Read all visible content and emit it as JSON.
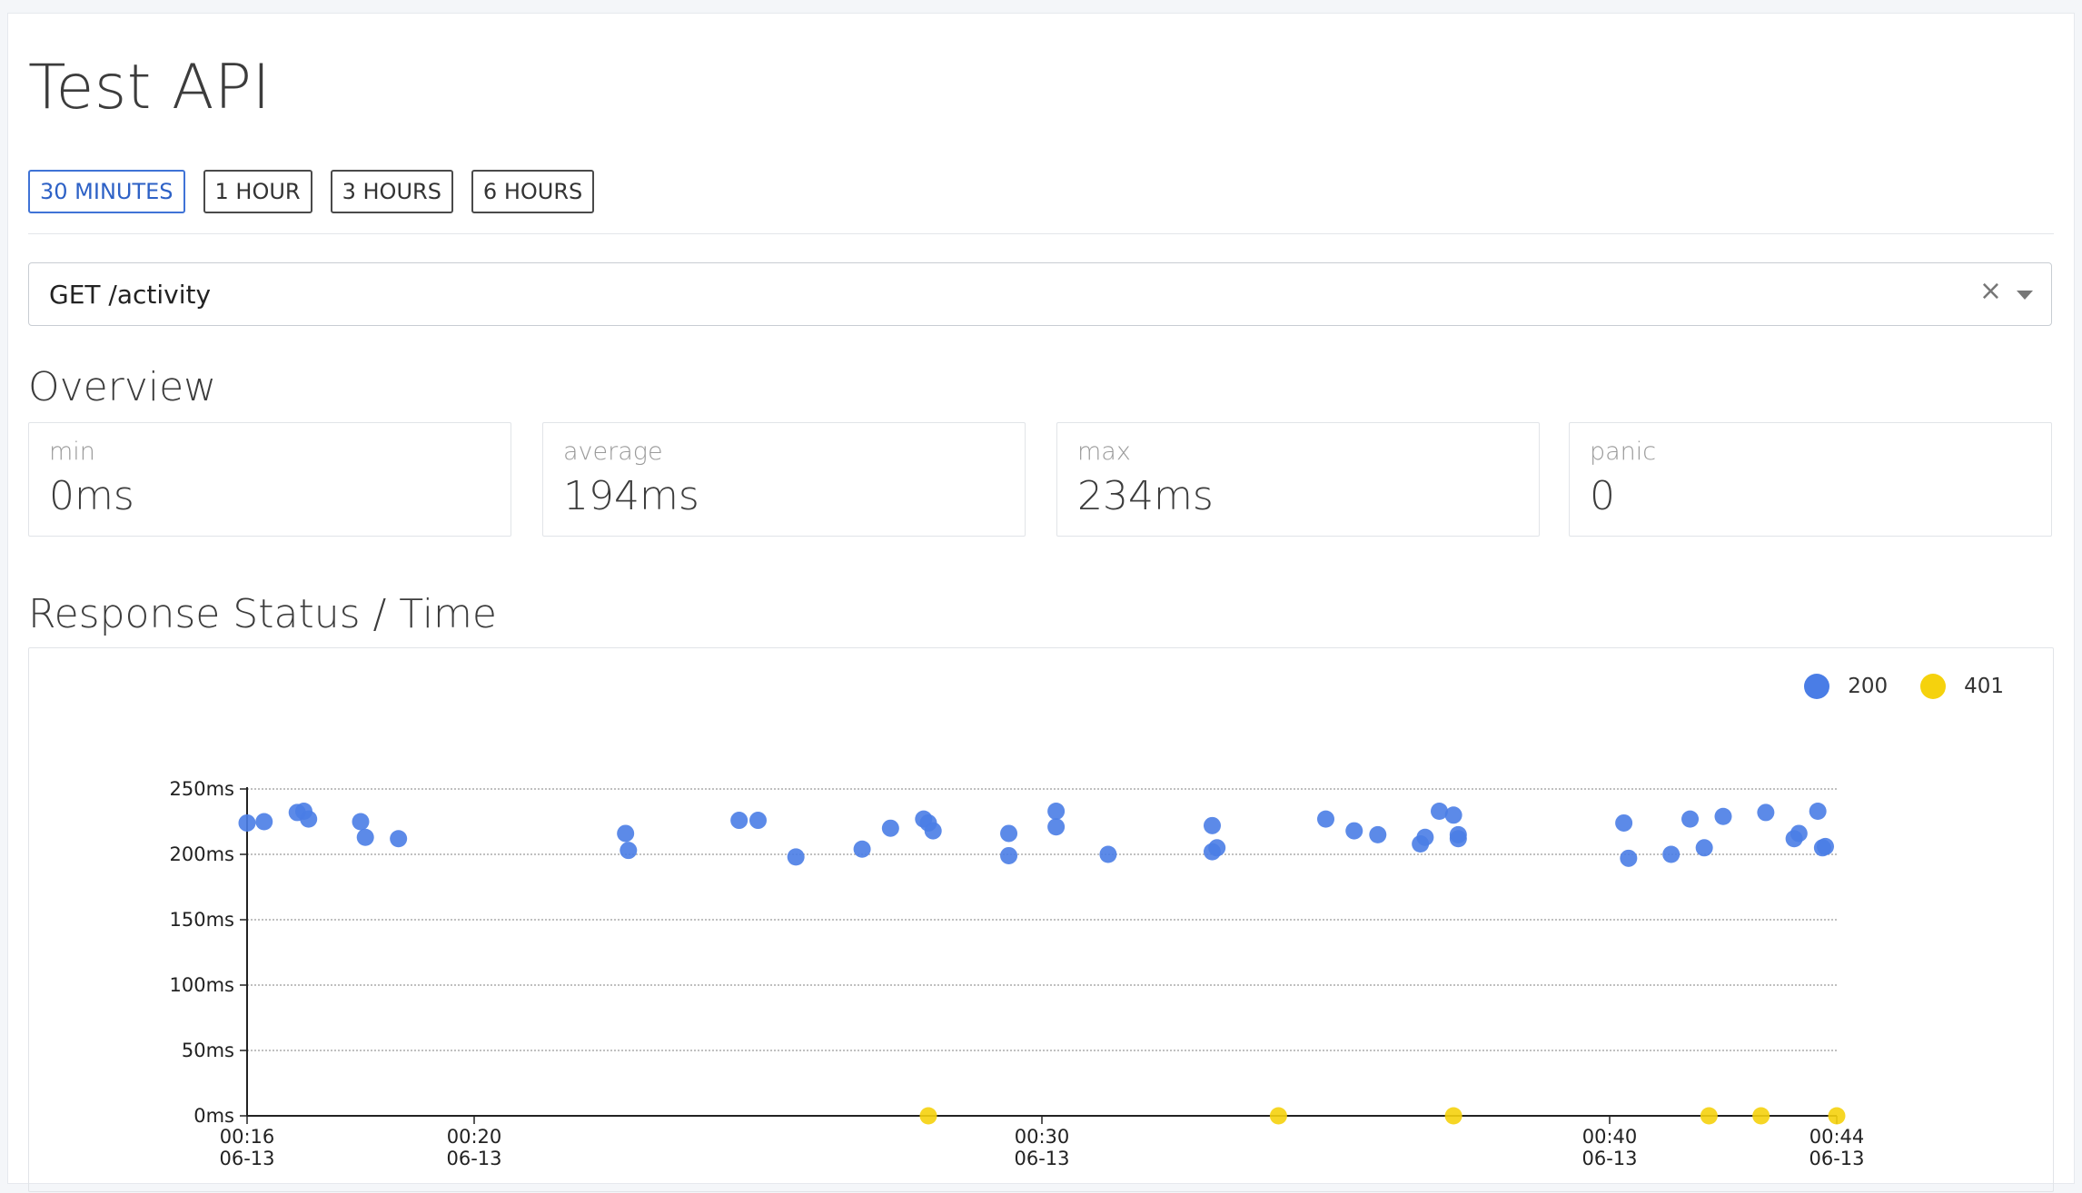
{
  "page": {
    "title": "Test API"
  },
  "time_ranges": [
    {
      "label": "30 MINUTES",
      "active": true
    },
    {
      "label": "1 HOUR",
      "active": false
    },
    {
      "label": "3 HOURS",
      "active": false
    },
    {
      "label": "6 HOURS",
      "active": false
    }
  ],
  "endpoint_select": {
    "value": "GET /activity",
    "clear_icon": "close-icon",
    "dropdown_icon": "caret-down-icon"
  },
  "overview": {
    "title": "Overview",
    "stats": [
      {
        "label": "min",
        "value": "0ms"
      },
      {
        "label": "average",
        "value": "194ms"
      },
      {
        "label": "max",
        "value": "234ms"
      },
      {
        "label": "panic",
        "value": "0"
      }
    ]
  },
  "response_chart": {
    "title": "Response Status / Time"
  },
  "chart_data": {
    "type": "scatter",
    "title": "Response Status / Time",
    "xlabel": "",
    "ylabel": "",
    "ylim": [
      0,
      250
    ],
    "y_ticks": [
      {
        "value": 0,
        "label": "0ms"
      },
      {
        "value": 50,
        "label": "50ms"
      },
      {
        "value": 100,
        "label": "100ms"
      },
      {
        "value": 150,
        "label": "150ms"
      },
      {
        "value": 200,
        "label": "200ms"
      },
      {
        "value": 250,
        "label": "250ms"
      }
    ],
    "x_ticks": [
      {
        "time": "00:16",
        "date": "06-13"
      },
      {
        "time": "00:20",
        "date": "06-13"
      },
      {
        "time": "00:30",
        "date": "06-13"
      },
      {
        "time": "00:40",
        "date": "06-13"
      },
      {
        "time": "00:44",
        "date": "06-13"
      }
    ],
    "grid": true,
    "legend_position": "top-right",
    "series": [
      {
        "name": "200",
        "color": "#4a7de6",
        "points": [
          [
            "00:16:00",
            224
          ],
          [
            "00:16:18",
            225
          ],
          [
            "00:16:53",
            232
          ],
          [
            "00:17:00",
            233
          ],
          [
            "00:17:05",
            227
          ],
          [
            "00:18:00",
            225
          ],
          [
            "00:18:05",
            213
          ],
          [
            "00:18:40",
            212
          ],
          [
            "00:22:40",
            216
          ],
          [
            "00:22:43",
            203
          ],
          [
            "00:24:40",
            226
          ],
          [
            "00:25:00",
            226
          ],
          [
            "00:25:40",
            198
          ],
          [
            "00:26:50",
            204
          ],
          [
            "00:27:20",
            220
          ],
          [
            "00:27:55",
            227
          ],
          [
            "00:28:00",
            224
          ],
          [
            "00:28:05",
            218
          ],
          [
            "00:29:25",
            216
          ],
          [
            "00:29:25",
            199
          ],
          [
            "00:30:15",
            233
          ],
          [
            "00:30:15",
            221
          ],
          [
            "00:31:10",
            200
          ],
          [
            "00:33:00",
            222
          ],
          [
            "00:33:00",
            202
          ],
          [
            "00:33:05",
            205
          ],
          [
            "00:35:00",
            227
          ],
          [
            "00:35:30",
            218
          ],
          [
            "00:35:55",
            215
          ],
          [
            "00:36:40",
            208
          ],
          [
            "00:36:45",
            213
          ],
          [
            "00:37:00",
            233
          ],
          [
            "00:37:15",
            230
          ],
          [
            "00:37:20",
            212
          ],
          [
            "00:37:20",
            215
          ],
          [
            "00:40:15",
            224
          ],
          [
            "00:40:20",
            197
          ],
          [
            "00:41:05",
            200
          ],
          [
            "00:41:25",
            227
          ],
          [
            "00:41:40",
            205
          ],
          [
            "00:42:00",
            229
          ],
          [
            "00:42:45",
            232
          ],
          [
            "00:43:15",
            212
          ],
          [
            "00:43:20",
            216
          ],
          [
            "00:43:40",
            233
          ],
          [
            "00:43:45",
            205
          ],
          [
            "00:43:48",
            206
          ]
        ]
      },
      {
        "name": "401",
        "color": "#f5d20d",
        "points": [
          [
            "00:28:00",
            0
          ],
          [
            "00:34:10",
            0
          ],
          [
            "00:37:15",
            0
          ],
          [
            "00:41:45",
            0
          ],
          [
            "00:42:40",
            0
          ],
          [
            "00:44:00",
            0
          ]
        ]
      }
    ]
  }
}
